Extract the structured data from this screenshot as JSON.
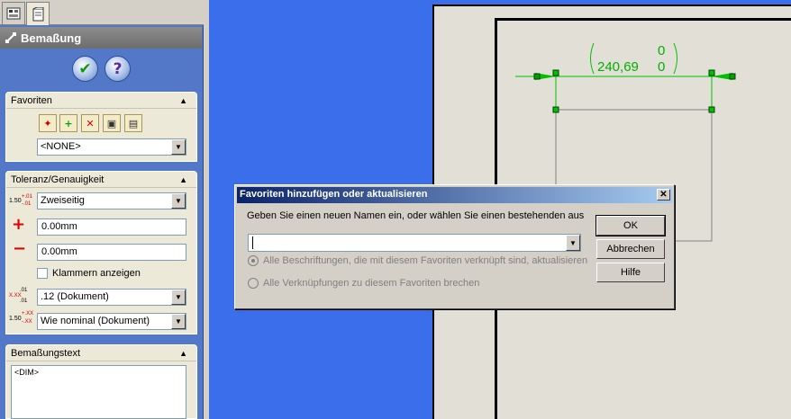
{
  "panel": {
    "tabs": [
      {
        "icon": "feature-tree-icon"
      },
      {
        "icon": "property-manager-icon"
      }
    ],
    "header_title": "Bemaßung",
    "ok_icon": "checkmark-icon",
    "help_icon": "question-icon",
    "favorites": {
      "title": "Favoriten",
      "selected": "<NONE>"
    },
    "tolerance": {
      "title": "Toleranz/Genauigkeit",
      "tol_type": "Zweiseitig",
      "plus_value": "0.00mm",
      "minus_value": "0.00mm",
      "brackets_label": "Klammern anzeigen",
      "precision": ".12 (Dokument)",
      "tol_precision": "Wie nominal (Dokument)",
      "icon_nominal": "1.50",
      "icon_plus": "+.01",
      "icon_minus": "-.01",
      "icon_prec_a": ".01",
      "icon_prec_b": "X.XX",
      "icon_prec_c": ".01",
      "icon_tprec_plus": "+.XX",
      "icon_tprec_minus": "-.XX"
    },
    "dimtext": {
      "title": "Bemaßungstext",
      "content": "<DIM>"
    }
  },
  "drawing": {
    "dim_upper": "0",
    "dim_main": "240,69",
    "dim_lower": "0",
    "accent": "#00c000"
  },
  "dialog": {
    "title": "Favoriten hinzufügen oder aktualisieren",
    "close_symbol": "✕",
    "prompt": "Geben Sie einen neuen Namen ein, oder wählen Sie einen bestehenden aus",
    "name_value": "",
    "option_update": "Alle Beschriftungen, die mit diesem Favoriten verknüpft sind, aktualisieren",
    "option_break": "Alle Verknüpfungen zu diesem Favoriten brechen",
    "ok": "OK",
    "cancel": "Abbrechen",
    "help": "Hilfe"
  }
}
